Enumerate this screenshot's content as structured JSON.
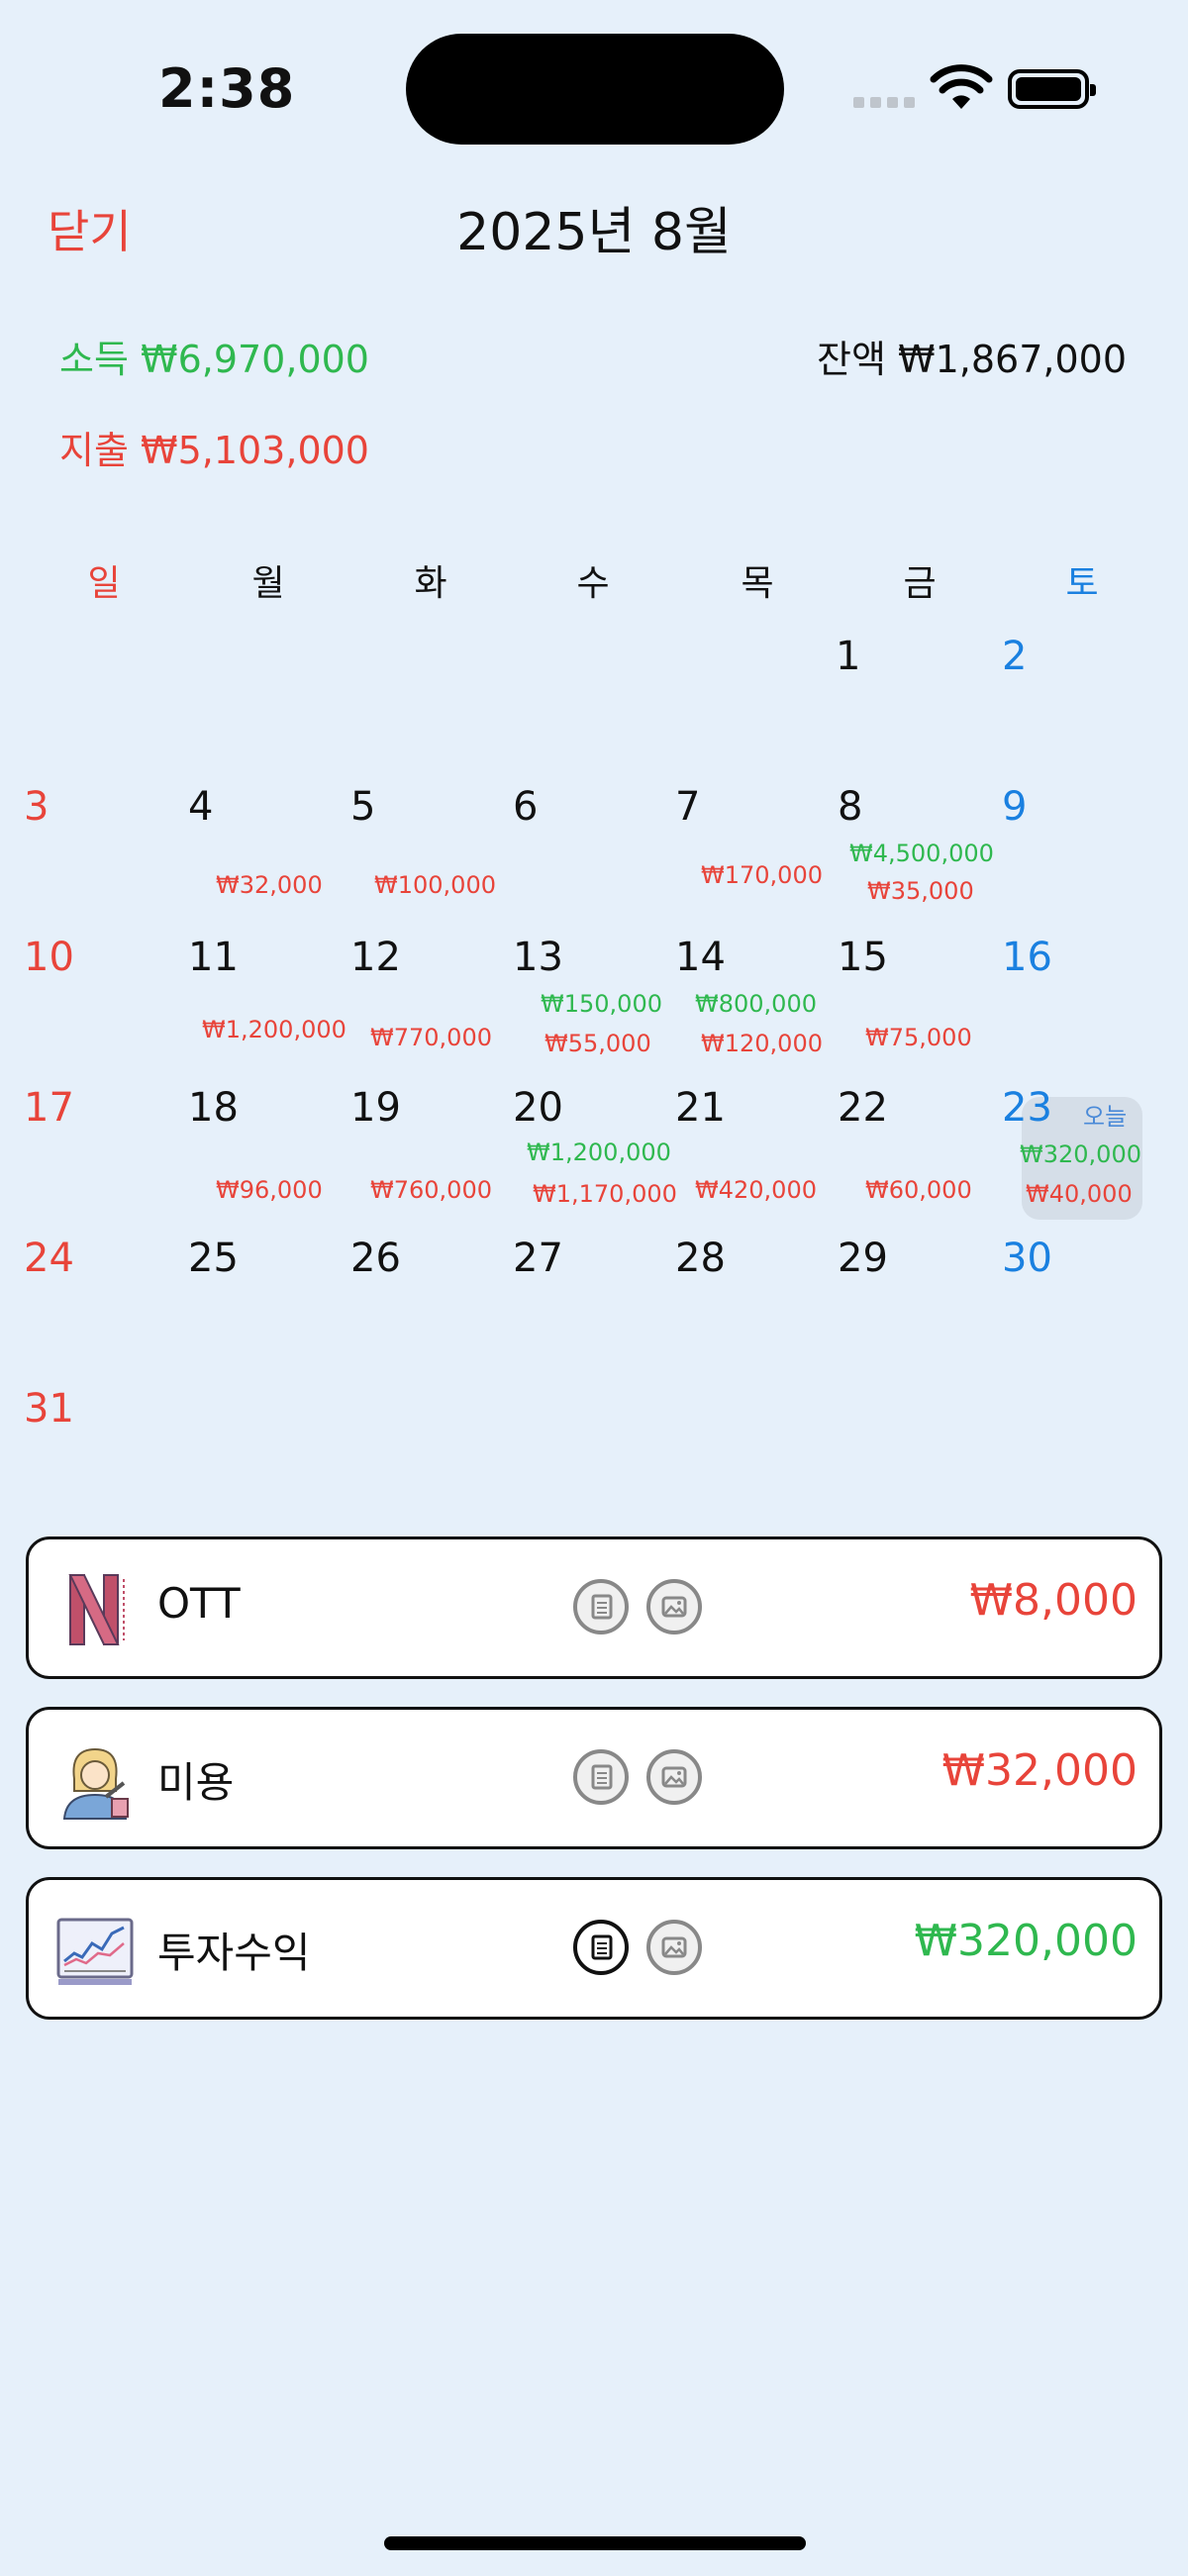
{
  "status": {
    "time": "2:38"
  },
  "header": {
    "close_label": "닫기",
    "title": "2025년 8월"
  },
  "summary": {
    "income": "소득 ₩6,970,000",
    "balance": "잔액 ₩1,867,000",
    "expense": "지출 ₩5,103,000"
  },
  "weekdays": [
    "일",
    "월",
    "화",
    "수",
    "목",
    "금",
    "토"
  ],
  "calendar": {
    "today_label": "오늘",
    "days": {
      "d1": {
        "num": "1"
      },
      "d2": {
        "num": "2"
      },
      "d3": {
        "num": "3"
      },
      "d4": {
        "num": "4",
        "out": "₩32,000"
      },
      "d5": {
        "num": "5",
        "out": "₩100,000"
      },
      "d6": {
        "num": "6"
      },
      "d7": {
        "num": "7",
        "out": "₩170,000"
      },
      "d8": {
        "num": "8",
        "in": "₩4,500,000",
        "out": "₩35,000"
      },
      "d9": {
        "num": "9"
      },
      "d10": {
        "num": "10"
      },
      "d11": {
        "num": "11",
        "out": "₩1,200,000"
      },
      "d12": {
        "num": "12",
        "out": "₩770,000"
      },
      "d13": {
        "num": "13",
        "in": "₩150,000",
        "out": "₩55,000"
      },
      "d14": {
        "num": "14",
        "in": "₩800,000",
        "out": "₩120,000"
      },
      "d15": {
        "num": "15",
        "out": "₩75,000"
      },
      "d16": {
        "num": "16"
      },
      "d17": {
        "num": "17"
      },
      "d18": {
        "num": "18",
        "out": "₩96,000"
      },
      "d19": {
        "num": "19",
        "out": "₩760,000"
      },
      "d20": {
        "num": "20",
        "in": "₩1,200,000",
        "out": "₩1,170,000"
      },
      "d21": {
        "num": "21",
        "out": "₩420,000"
      },
      "d22": {
        "num": "22",
        "out": "₩60,000"
      },
      "d23": {
        "num": "23",
        "in": "₩320,000",
        "out": "₩40,000"
      },
      "d24": {
        "num": "24"
      },
      "d25": {
        "num": "25"
      },
      "d26": {
        "num": "26"
      },
      "d27": {
        "num": "27"
      },
      "d28": {
        "num": "28"
      },
      "d29": {
        "num": "29"
      },
      "d30": {
        "num": "30"
      },
      "d31": {
        "num": "31"
      }
    }
  },
  "transactions": [
    {
      "name": "OTT",
      "amount": "₩8,000",
      "type": "expense",
      "icon": "netflix-icon"
    },
    {
      "name": "미용",
      "amount": "₩32,000",
      "type": "expense",
      "icon": "beauty-icon"
    },
    {
      "name": "투자수익",
      "amount": "₩320,000",
      "type": "income",
      "icon": "investment-chart-icon"
    }
  ],
  "colors": {
    "background": "#e6f0fa",
    "income": "#2fb84f",
    "expense": "#e8443a",
    "saturday": "#1a80e0"
  }
}
